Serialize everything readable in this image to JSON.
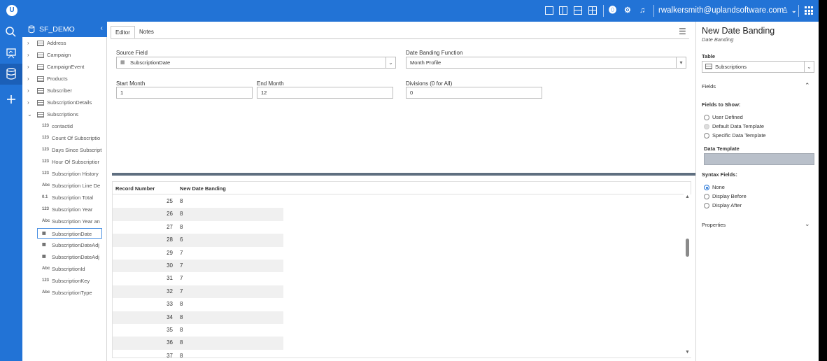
{
  "topbar": {
    "logo": "U",
    "user": "rwalkersmith@uplandsoftware.com",
    "icons": [
      "layout-single-icon",
      "layout-split-vertical-icon",
      "layout-split-horizontal-icon",
      "layout-quad-icon",
      "help-icon",
      "settings-icon",
      "bell-icon",
      "user-icon",
      "chevron-down-icon",
      "apps-grid-icon"
    ]
  },
  "rail": {
    "items": [
      "search-icon",
      "dashboard-icon",
      "database-icon",
      "add-icon"
    ]
  },
  "sidebar": {
    "title": "SF_DEMO",
    "collapse_glyph": "‹",
    "tables": [
      {
        "label": "Address",
        "expanded": false
      },
      {
        "label": "Campaign",
        "expanded": false
      },
      {
        "label": "CampaignEvent",
        "expanded": false
      },
      {
        "label": "Products",
        "expanded": false
      },
      {
        "label": "Subscriber",
        "expanded": false
      },
      {
        "label": "SubscriptionDetails",
        "expanded": false
      },
      {
        "label": "Subscriptions",
        "expanded": true
      }
    ],
    "fields": [
      {
        "type": "123",
        "label": "contactid"
      },
      {
        "type": "123",
        "label": "Count Of Subscriptio"
      },
      {
        "type": "123",
        "label": "Days Since Subscript"
      },
      {
        "type": "123",
        "label": "Hour Of Subscriptior"
      },
      {
        "type": "123",
        "label": "Subscription History"
      },
      {
        "type": "Abc",
        "label": "Subscription Line De"
      },
      {
        "type": "0.1",
        "label": "Subscription Total"
      },
      {
        "type": "123",
        "label": "Subscription Year"
      },
      {
        "type": "Abc",
        "label": "Subscription Year an"
      },
      {
        "type": "date",
        "label": "SubscriptionDate",
        "selected": true
      },
      {
        "type": "date",
        "label": "SubscriptionDateAdj"
      },
      {
        "type": "date",
        "label": "SubscriptionDateAdj"
      },
      {
        "type": "Abc",
        "label": "SubscriptionId"
      },
      {
        "type": "123",
        "label": "SubscriptionKey"
      },
      {
        "type": "Abc",
        "label": "SubscriptionType"
      }
    ]
  },
  "editor": {
    "tabs": [
      {
        "label": "Editor",
        "active": true
      },
      {
        "label": "Notes",
        "active": false
      }
    ],
    "source_field": {
      "label": "Source Field",
      "value": "SubscriptionDate"
    },
    "banding_function": {
      "label": "Date Banding Function",
      "value": "Month Profile"
    },
    "start_month": {
      "label": "Start Month",
      "value": "1"
    },
    "end_month": {
      "label": "End Month",
      "value": "12"
    },
    "divisions": {
      "label": "Divisions (0 for All)",
      "value": "0"
    }
  },
  "results": {
    "columns": [
      "Record Number",
      "New Date Banding"
    ],
    "rows": [
      {
        "num": "25",
        "val": "8"
      },
      {
        "num": "26",
        "val": "8"
      },
      {
        "num": "27",
        "val": "8"
      },
      {
        "num": "28",
        "val": "6"
      },
      {
        "num": "29",
        "val": "7"
      },
      {
        "num": "30",
        "val": "7"
      },
      {
        "num": "31",
        "val": "7"
      },
      {
        "num": "32",
        "val": "7"
      },
      {
        "num": "33",
        "val": "8"
      },
      {
        "num": "34",
        "val": "8"
      },
      {
        "num": "35",
        "val": "8"
      },
      {
        "num": "36",
        "val": "8"
      },
      {
        "num": "37",
        "val": "8"
      }
    ]
  },
  "properties": {
    "title": "New Date Banding",
    "subtitle": "Date Banding",
    "table_label": "Table",
    "table_value": "Subscriptions",
    "fields_section": "Fields",
    "fields_to_show_label": "Fields to Show:",
    "fields_to_show": [
      {
        "label": "User Defined",
        "state": "off"
      },
      {
        "label": "Default Data Template",
        "state": "disabled"
      },
      {
        "label": "Specific Data Template",
        "state": "off"
      }
    ],
    "data_template_label": "Data Template",
    "syntax_fields_label": "Syntax Fields:",
    "syntax_fields": [
      {
        "label": "None",
        "state": "on"
      },
      {
        "label": "Display Before",
        "state": "off"
      },
      {
        "label": "Display After",
        "state": "off"
      }
    ],
    "properties_section": "Properties"
  }
}
